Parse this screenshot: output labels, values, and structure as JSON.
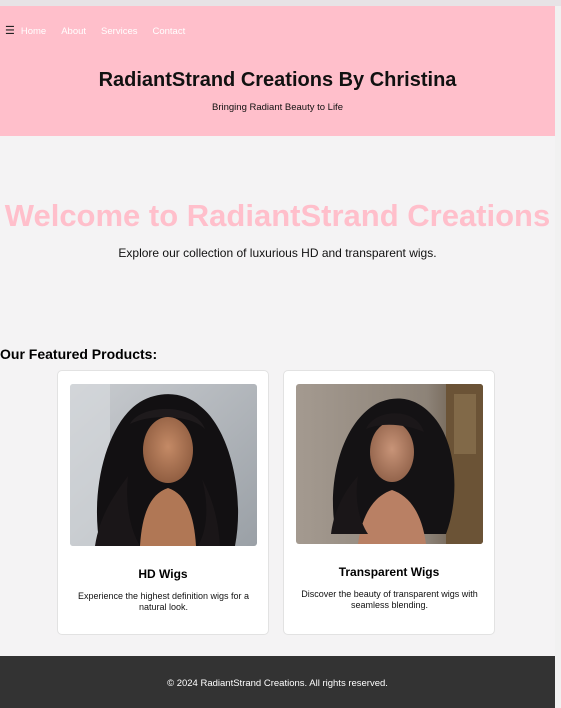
{
  "header": {
    "nav": {
      "menu_icon": "hamburger-icon",
      "items": [
        {
          "label": "Home"
        },
        {
          "label": "About"
        },
        {
          "label": "Services"
        },
        {
          "label": "Contact"
        }
      ]
    },
    "title": "RadiantStrand Creations By Christina",
    "tagline": "Bringing Radiant Beauty to Life"
  },
  "hero": {
    "title": "Welcome to RadiantStrand Creations",
    "subtitle": "Explore our collection of luxurious HD and transparent wigs."
  },
  "featured": {
    "heading": "Our Featured Products:",
    "products": [
      {
        "name": "HD Wigs",
        "description": "Experience the highest definition wigs for a natural look."
      },
      {
        "name": "Transparent Wigs",
        "description": "Discover the beauty of transparent wigs with seamless blending."
      }
    ]
  },
  "footer": {
    "copyright": "© 2024 RadiantStrand Creations. All rights reserved."
  },
  "colors": {
    "header_bg": "#ffbfcb",
    "accent_pink": "#ffbfcb",
    "page_bg": "#f4f3f4",
    "footer_bg": "#333333"
  }
}
